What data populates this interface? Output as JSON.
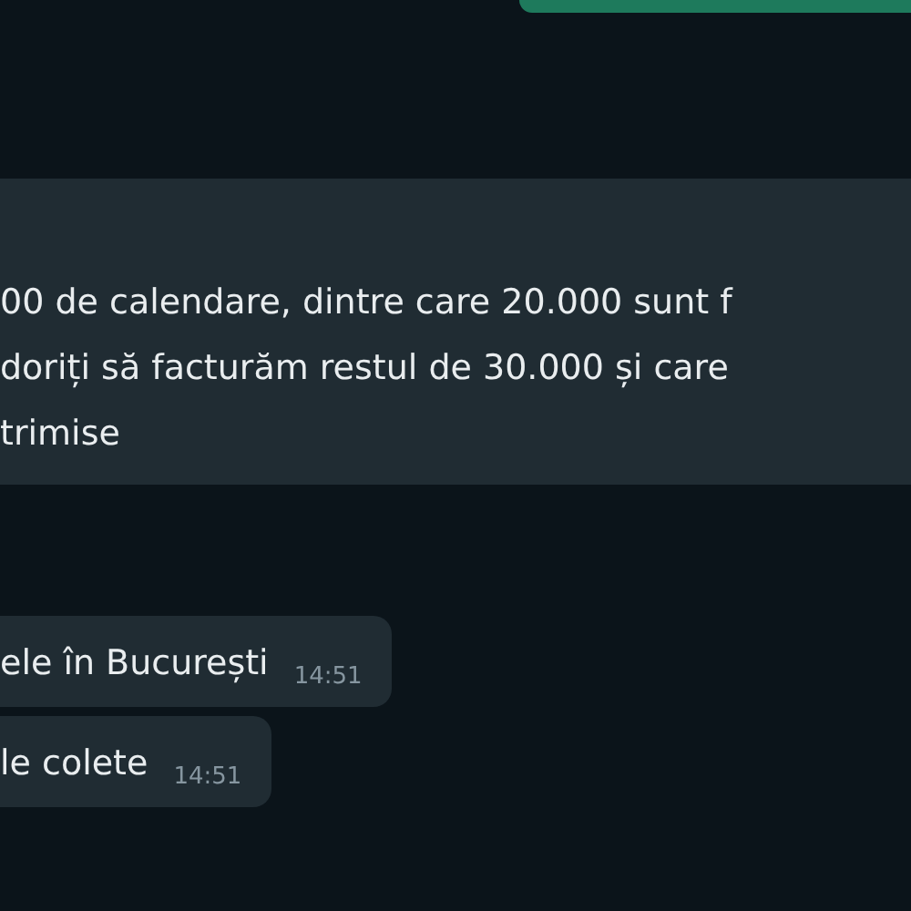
{
  "outgoing_bubble": {
    "kind": "outgoing"
  },
  "messages": [
    {
      "kind": "incoming",
      "lines": [
        "00 de calendare, dintre care 20.000 sunt f",
        "doriți să facturăm restul de 30.000 și care",
        "trimise"
      ]
    },
    {
      "kind": "incoming",
      "lines": [
        "ele în București"
      ],
      "time": "14:51"
    },
    {
      "kind": "incoming",
      "lines": [
        "le colete"
      ],
      "time": "14:51"
    }
  ]
}
